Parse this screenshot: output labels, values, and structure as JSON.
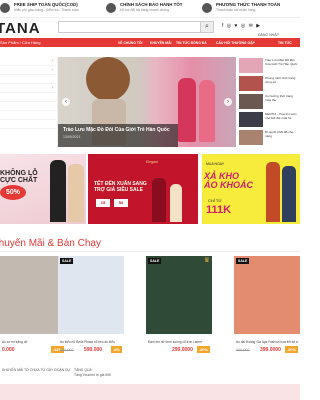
{
  "top_strip": [
    {
      "title": "FREE SHIP TOÀN QUỐC(COD)",
      "sub": "Miễn phí giao hàng - Kiểm tra - Thanh toán"
    },
    {
      "title": "CHÍNH SÁCH BẢO HÀNH TỐT",
      "sub": "Hỗ trợ đổi trả hàng nhanh chóng"
    },
    {
      "title": "PHƯƠNG THỨC THANH TOÁN",
      "sub": "Thanh toán khi nhận hàng"
    }
  ],
  "header": {
    "logo": "TANA",
    "search_placeholder": "",
    "search_icon": "search-icon",
    "social": "f ◎ ♥ ◎ ✉ ▶",
    "account": "ĐĂNG NHẬP"
  },
  "nav": {
    "category": "Sản Phẩm / Cửa Hàng",
    "links": [
      "VỀ CHÚNG TÔI",
      "KHUYẾN MÃI",
      "TIN TỨC BÓNG ĐÁ",
      "CÂU HỎI THƯỜNG GẶP",
      "TIN TỨC"
    ]
  },
  "slider": {
    "caption": "Trào Lưu Mặc Đồ Đôi Của Giới Trẻ Hàn Quốc",
    "date": "13/09/2021",
    "prev": "‹",
    "next": "›"
  },
  "news": [
    {
      "text": "Trào Lưu Mặc Đồ Đôi Của Giới Trẻ Hàn Quốc",
      "color": "#e2a6b6"
    },
    {
      "text": "Phong cách thời trang công sở",
      "color": "#b3534d"
    },
    {
      "text": "Xu hướng thời trang mùa thu",
      "color": "#6b5850"
    },
    {
      "text": "DENTIX - Hoa tim luôn nhớ Đồ đôi mùa hè",
      "color": "#3c3c48"
    },
    {
      "text": "Bí quyết phối đồ cho nàng",
      "color": "#a88470"
    }
  ],
  "banners": {
    "b1_title": "KHÔNG LỖ\nCỰC CHẤT",
    "b1_sale": "50%",
    "b2_logo": "Elegant",
    "b2_text": "TẾT ĐẾN XUÂN SANG\nTRỢ GIÁ SIÊU SALE",
    "b2_v1": "15",
    "b2_v2": "50",
    "b3_top": "MUA NGAY",
    "b3_title": "XẢ KHO\nÁO KHOÁC",
    "b3_from": "CHỈ TỪ",
    "b3_price": "111K"
  },
  "section": {
    "title": "Khuyến Mãi & Bán Chạy"
  },
  "products": [
    {
      "name": "Áo sơ mi trắng nữ",
      "old": "",
      "new": "0.000",
      "disc": "-42%",
      "sale": "",
      "crown": "♛",
      "img": "#c2b9b1"
    },
    {
      "name": "Áo kiểu nữ Bella Plusta cổ bèo áo kiểu",
      "old": "599.000",
      "new": "590.000",
      "disc": "-8%",
      "sale": "SALE",
      "crown": "",
      "img": "#dfe6ef"
    },
    {
      "name": "Đầm len nữ form suông cổ tròn Lamer",
      "old": "",
      "new": "299.0000",
      "disc": "-20%",
      "sale": "SALE",
      "crown": "♛",
      "img": "#2f4a36"
    },
    {
      "name": "Áo dài Hoàng Gia Aya Fashion hoa tiết kẻ sọc",
      "old": "369.000",
      "new": "399.0000",
      "disc": "-20%",
      "sale": "SALE",
      "crown": "",
      "img": "#e38c6f"
    }
  ],
  "promo_row": {
    "a": "KHUYẾN MÃI TÒ CHƯA TỪ GÂY ĐOÀN DỰ",
    "b": "TẶNG QUÀ",
    "c": "Tặng Voucher trị giá 50K"
  }
}
